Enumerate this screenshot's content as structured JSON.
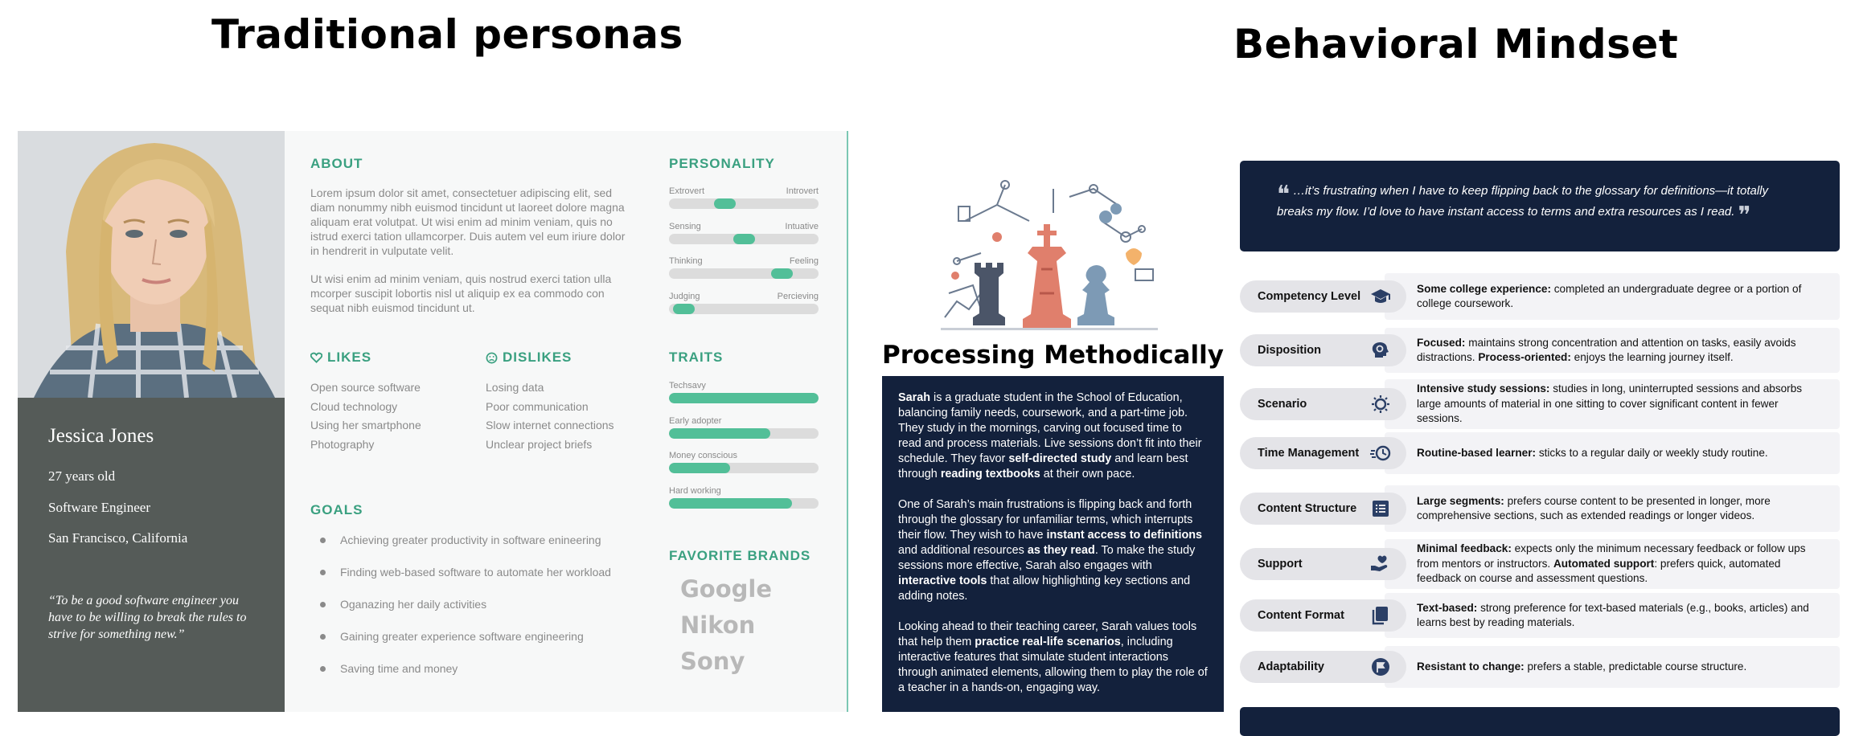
{
  "headings": {
    "left": "Traditional personas",
    "right": "Behavioral Mindset"
  },
  "persona": {
    "name": "Jessica Jones",
    "age": "27 years old",
    "job": "Software Engineer",
    "location": "San Francisco, California",
    "quote": "“To be a good software engineer you have to be willing to break the rules to strive for something new.”",
    "about_title": "ABOUT",
    "about_p1": "Lorem ipsum dolor sit amet, consectetuer adipiscing elit, sed diam nonummy nibh euismod tincidunt ut laoreet dolore magna aliquam erat volutpat. Ut wisi enim ad minim veniam, quis no istrud exerci tation ullamcorper. Duis autem vel eum iriure dolor in hendrerit in vulputate velit.",
    "about_p2": "Ut wisi enim ad minim veniam, quis nostrud exerci tation ulla mcorper suscipit lobortis nisl ut aliquip ex ea commodo con sequat nibh euismod tincidunt ut.",
    "likes_title": "LIKES",
    "likes": [
      "Open source software",
      "Cloud technology",
      "Using her smartphone",
      "Photography"
    ],
    "dislikes_title": "DISLIKES",
    "dislikes": [
      "Losing data",
      "Poor communication",
      "Slow internet connections",
      "Unclear project briefs"
    ],
    "goals_title": "GOALS",
    "goals": [
      "Achieving greater productivity in software enineering",
      "Finding web-based software to automate her workload",
      "Oganazing her daily activities",
      "Gaining greater experience software engineering",
      "Saving time and money"
    ],
    "personality_title": "PERSONALITY",
    "personality": [
      {
        "left": "Extrovert",
        "right": "Introvert",
        "value": 0.35
      },
      {
        "left": "Sensing",
        "right": "Intuative",
        "value": 0.5
      },
      {
        "left": "Thinking",
        "right": "Feeling",
        "value": 0.8
      },
      {
        "left": "Judging",
        "right": "Percieving",
        "value": 0.03
      }
    ],
    "traits_title": "TRAITS",
    "traits": [
      {
        "label": "Techsavy",
        "value": 1.0
      },
      {
        "label": "Early adopter",
        "value": 0.68
      },
      {
        "label": "Money conscious",
        "value": 0.41
      },
      {
        "label": "Hard working",
        "value": 0.82
      }
    ],
    "brands_title": "FAVORITE BRANDS",
    "brands": [
      "Google",
      "Nikon",
      "Sony"
    ]
  },
  "middle": {
    "title": "Processing Methodically",
    "p1": "<b>Sarah</b> is a graduate student in the School of Education, balancing family needs, coursework, and a part-time job. They study in the mornings, carving out focused time to read and process materials. Live sessions don’t fit into their schedule. They favor <b>self-directed study</b> and learn best through <b>reading textbooks</b> at their own pace.",
    "p2": "One of Sarah’s main frustrations is flipping back and forth through the glossary for unfamiliar terms, which interrupts their flow. They wish to have <b>instant access to definitions</b> and additional resources <b>as they read</b>. To make the study sessions more effective, Sarah also engages with <b>interactive tools</b> that allow highlighting key sections and adding notes.",
    "p3": "Looking ahead to their teaching career, Sarah values tools that help them <b>practice real-life scenarios</b>, including interactive features that simulate student interactions through animated elements, allowing them to play the role of a teacher in a hands-on, engaging way."
  },
  "right": {
    "quote": "…it’s frustrating when I have to keep flipping back to the glossary for definitions—it totally breaks my flow. I’d love to have instant access to terms and extra resources as I read.",
    "rows": [
      {
        "label": "Competency Level",
        "icon": "graduation-cap-icon",
        "text": "<b>Some college experience:</b> completed an undergraduate degree or a portion of college coursework."
      },
      {
        "label": "Disposition",
        "icon": "head-gear-icon",
        "text": "<b>Focused:</b> maintains strong concentration and attention on tasks, easily avoids distractions. <b>Process-oriented:</b> enjoys the learning journey itself."
      },
      {
        "label": "Scenario",
        "icon": "sun-gear-icon",
        "text": "<b>Intensive study sessions:</b> studies in long, uninterrupted sessions and absorbs large amounts of material in one sitting to cover significant content in fewer sessions."
      },
      {
        "label": "Time Management",
        "icon": "fast-clock-icon",
        "text": "<b>Routine-based learner:</b> sticks to a regular daily or weekly study routine."
      },
      {
        "label": "Content Structure",
        "icon": "list-doc-icon",
        "text": "<b>Large segments:</b> prefers course content to be presented in longer, more comprehensive sections, such as extended readings or longer videos."
      },
      {
        "label": "Support",
        "icon": "hand-heart-icon",
        "text": "<b>Minimal feedback:</b> expects only the minimum necessary feedback or follow ups from mentors or instructors. <b>Automated support</b>: prefers quick, automated feedback on course and assessment questions."
      },
      {
        "label": "Content Format",
        "icon": "copy-doc-icon",
        "text": "<b>Text-based:</b> strong preference for text-based materials (e.g., books, articles) and learns best by reading materials."
      },
      {
        "label": "Adaptability",
        "icon": "flag-circle-icon",
        "text": "<b>Resistant to change:</b> prefers a stable, predictable course structure."
      }
    ]
  }
}
